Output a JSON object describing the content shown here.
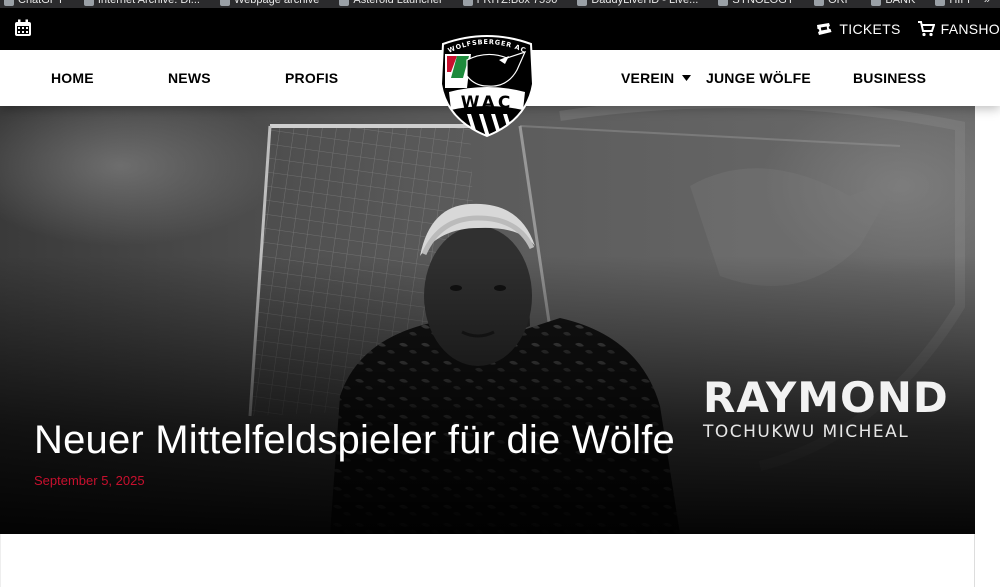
{
  "browser": {
    "bookmarks": [
      {
        "label": "ChatGPT",
        "icon": "chatgpt-icon"
      },
      {
        "label": "Internet Archive: Di...",
        "icon": "archive-icon"
      },
      {
        "label": "Webpage archive",
        "icon": "archive-icon"
      },
      {
        "label": "Asteroid Launcher",
        "icon": "asteroid-icon"
      },
      {
        "label": "FRITZ!Box 7590",
        "icon": "fritz-icon"
      },
      {
        "label": "DaddyLiveHD - Live...",
        "icon": "globe-icon"
      },
      {
        "label": "SYNOLOGY",
        "icon": "synology-icon"
      },
      {
        "label": "ORF",
        "icon": "folder-icon"
      },
      {
        "label": "BANK",
        "icon": "folder-icon"
      },
      {
        "label": "HIFI",
        "icon": "folder-icon"
      }
    ],
    "overflow": "»"
  },
  "topbar": {
    "tickets": "TICKETS",
    "fanshop": "FANSHO"
  },
  "nav": {
    "home": "HOME",
    "news": "NEWS",
    "profis": "PROFIS",
    "verein": "VEREIN",
    "junge_woelfe": "JUNGE WÖLFE",
    "business": "BUSINESS"
  },
  "logo": {
    "arc_text": "WOLFSBERGER AC",
    "letters": "WAC"
  },
  "hero": {
    "title": "Neuer Mittelfeldspieler für die Wölfe",
    "date": "September 5, 2025",
    "player_first": "RAYMOND",
    "player_rest": "TOCHUKWU MICHEAL"
  },
  "colors": {
    "accent_red": "#c8102e",
    "accent_green": "#1e8b3c",
    "topbar_bg": "#000000"
  }
}
